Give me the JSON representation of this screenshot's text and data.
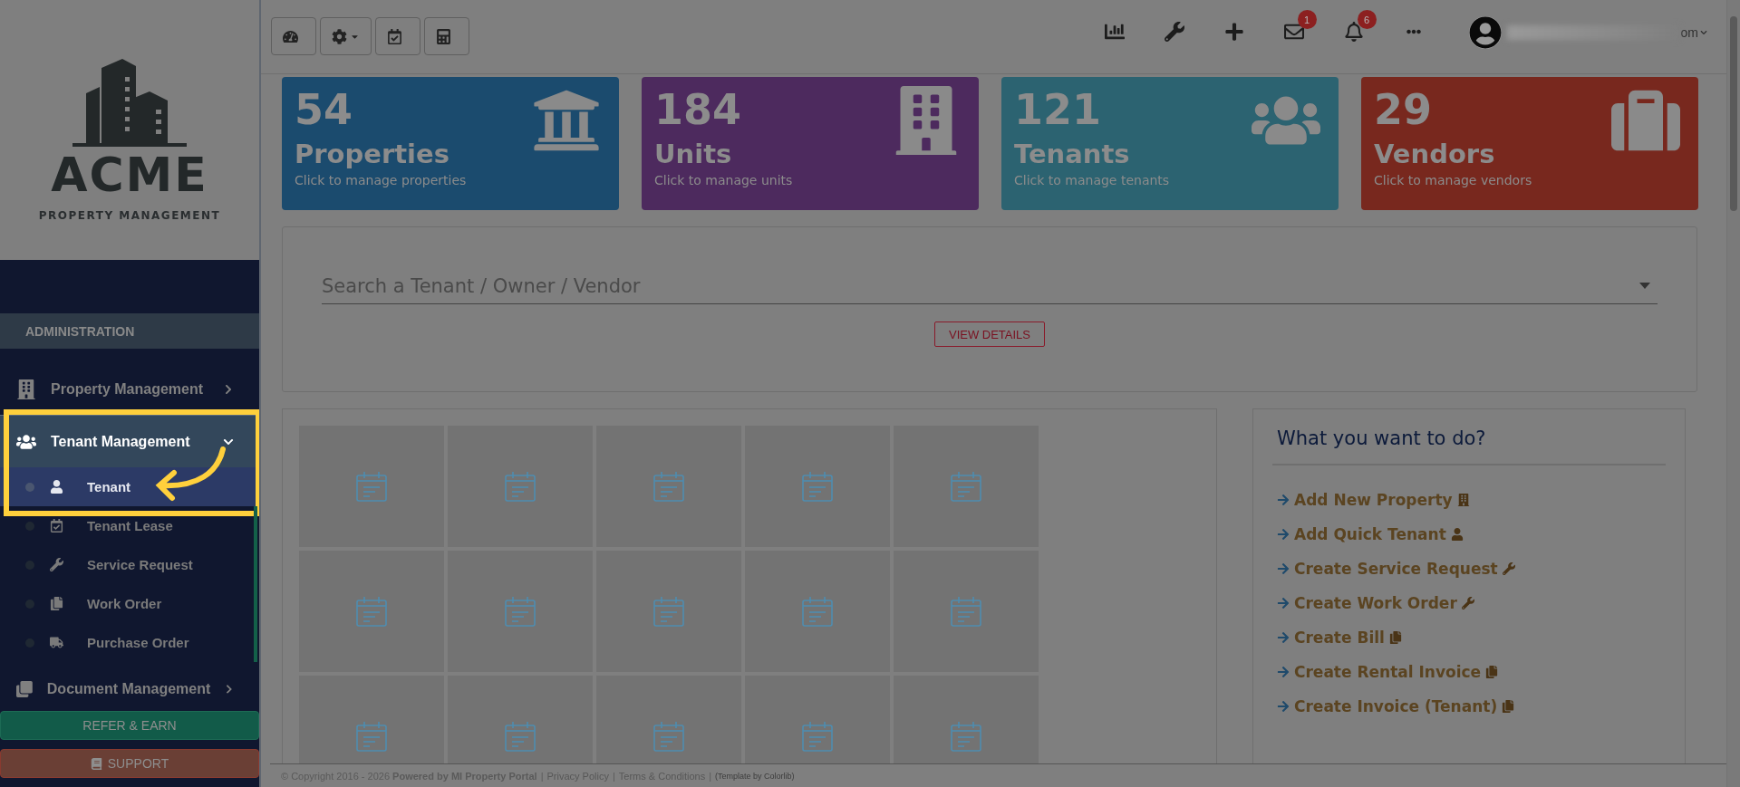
{
  "logo": {
    "name": "ACME",
    "tagline": "PROPERTY MANAGEMENT"
  },
  "sidebar": {
    "section": "ADMINISTRATION",
    "items": [
      {
        "label": "Property Management",
        "expanded": false,
        "highlighted": false
      },
      {
        "label": "Tenant Management",
        "expanded": true,
        "highlighted": true,
        "children": [
          {
            "label": "Tenant",
            "selected": true
          },
          {
            "label": "Tenant Lease",
            "selected": false
          },
          {
            "label": "Service Request",
            "selected": false
          },
          {
            "label": "Work Order",
            "selected": false
          },
          {
            "label": "Purchase Order",
            "selected": false
          }
        ]
      },
      {
        "label": "Document Management",
        "expanded": false,
        "highlighted": false
      }
    ],
    "buttons": [
      {
        "label": "REFER & EARN",
        "kind": "refer"
      },
      {
        "label": "SUPPORT",
        "kind": "support"
      }
    ]
  },
  "toolbar": {
    "mail_badge": "1",
    "bell_badge": "6",
    "user": {
      "email_visible": "om"
    }
  },
  "stats": [
    {
      "count": "54",
      "title": "Properties",
      "subtitle": "Click to manage properties",
      "color": "#1b4b6e"
    },
    {
      "count": "184",
      "title": "Units",
      "subtitle": "Click to manage units",
      "color": "#4d2a5e"
    },
    {
      "count": "121",
      "title": "Tenants",
      "subtitle": "Click to manage tenants",
      "color": "#2c6371"
    },
    {
      "count": "29",
      "title": "Vendors",
      "subtitle": "Click to manage vendors",
      "color": "#78281e"
    }
  ],
  "search": {
    "placeholder": "Search a Tenant / Owner / Vendor",
    "button": "VIEW DETAILS"
  },
  "tiles": [
    {
      "kind": "calendar"
    },
    {
      "kind": "calendar"
    },
    {
      "kind": "calendar"
    },
    {
      "kind": "calendar"
    },
    {
      "kind": "calendar"
    },
    {
      "kind": "calendar"
    },
    {
      "kind": "calendar"
    },
    {
      "kind": "calendar"
    },
    {
      "kind": "calendar"
    },
    {
      "kind": "calendar"
    },
    {
      "kind": "calendar"
    },
    {
      "kind": "calendar"
    },
    {
      "kind": "calendar"
    },
    {
      "kind": "calendar"
    },
    {
      "kind": "calendar"
    }
  ],
  "quick_actions": {
    "title": "What you want to do?",
    "items": [
      {
        "label": "Add New Property"
      },
      {
        "label": "Add Quick Tenant"
      },
      {
        "label": "Create Service Request"
      },
      {
        "label": "Create Work Order"
      },
      {
        "label": "Create Bill"
      },
      {
        "label": "Create Rental Invoice"
      },
      {
        "label": "Create Invoice (Tenant)"
      }
    ]
  },
  "footer": {
    "copyright": "© Copyright 2016 - 2026 **Powered by MI Property Portal**",
    "links": [
      "Privacy Policy",
      "Terms & Conditions"
    ],
    "separator": "|",
    "credit": "(Template by Colorlib)"
  }
}
